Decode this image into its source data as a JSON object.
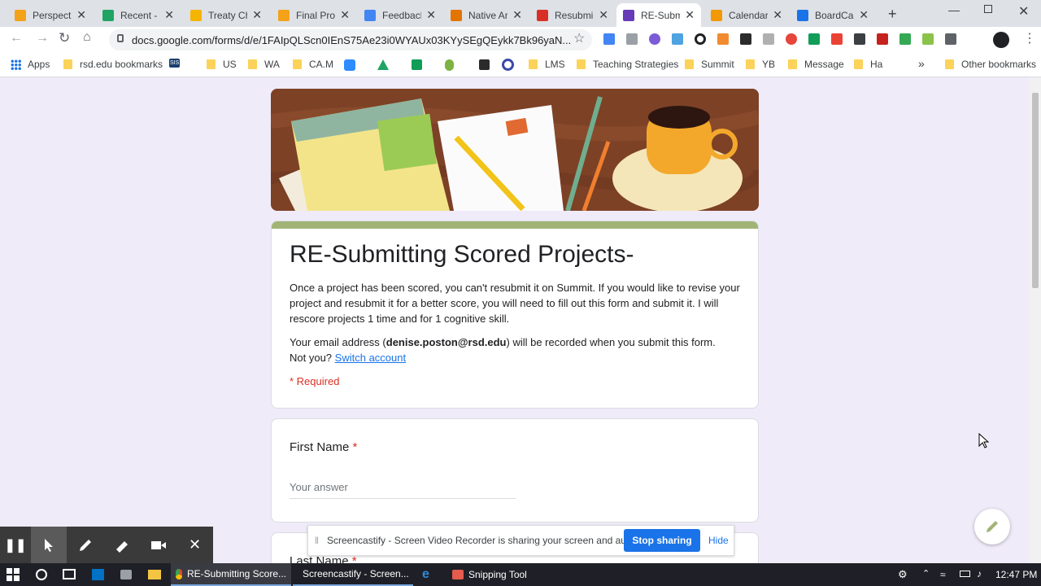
{
  "tabs": [
    {
      "label": "Perspecti",
      "icon": "sun-icon",
      "color": "#f4a21a"
    },
    {
      "label": "Recent -",
      "icon": "drive-icon",
      "color": "#1fa463"
    },
    {
      "label": "Treaty Ch",
      "icon": "slides-icon",
      "color": "#f4b400"
    },
    {
      "label": "Final Pro",
      "icon": "sun-icon",
      "color": "#f4a21a"
    },
    {
      "label": "Feedback",
      "icon": "docs-icon",
      "color": "#4285f4"
    },
    {
      "label": "Native Ar",
      "icon": "ngss-icon",
      "color": "#e37400"
    },
    {
      "label": "Resubmi",
      "icon": "ring-icon",
      "color": "#d93025"
    },
    {
      "label": "RE-Subm",
      "icon": "forms-icon",
      "color": "#673ab7"
    },
    {
      "label": "Calendar",
      "icon": "rainbow-icon",
      "color": "#f29900"
    },
    {
      "label": "BoardCal",
      "icon": "boardcal-icon",
      "color": "#1a73e8"
    }
  ],
  "url": "docs.google.com/forms/d/e/1FAIpQLScn0IEnS75Ae23i0WYAUx03KYySEgQEykk7Bk96yaN...",
  "bookmarks": {
    "apps": "Apps",
    "items": [
      "rsd.edu bookmarks",
      "US",
      "WA",
      "CA.M",
      "LMS",
      "Teaching Strategies",
      "Summit",
      "YB",
      "Message",
      "Ha"
    ],
    "sis": "SIS",
    "more": "»",
    "other": "Other bookmarks"
  },
  "form": {
    "title": "RE-Submitting Scored Projects-",
    "description": "Once a project has been scored, you can't resubmit it on Summit.  If you would like to revise your project and resubmit it for a better score, you will need to fill out this form and submit it. I will rescore projects 1 time and for 1 cognitive skill.",
    "email_prefix": "Your email address (",
    "email": "denise.poston@rsd.edu",
    "email_suffix": ") will be recorded when you submit this form.",
    "not_you": "Not you?",
    "switch": "Switch account",
    "required": "* Required",
    "q1_label": "First Name",
    "q1_placeholder": "Your answer",
    "q2_label": "Last Name",
    "star": "*",
    "accent": "#a1b476"
  },
  "screencastify": {
    "message": "Screencastify - Screen Video Recorder is sharing your screen and audio.",
    "stop": "Stop sharing",
    "hide": "Hide"
  },
  "taskbar": {
    "items": [
      "RE-Submitting Score...",
      "Screencastify - Screen...",
      "Snipping Tool"
    ],
    "time": "12:47 PM"
  }
}
